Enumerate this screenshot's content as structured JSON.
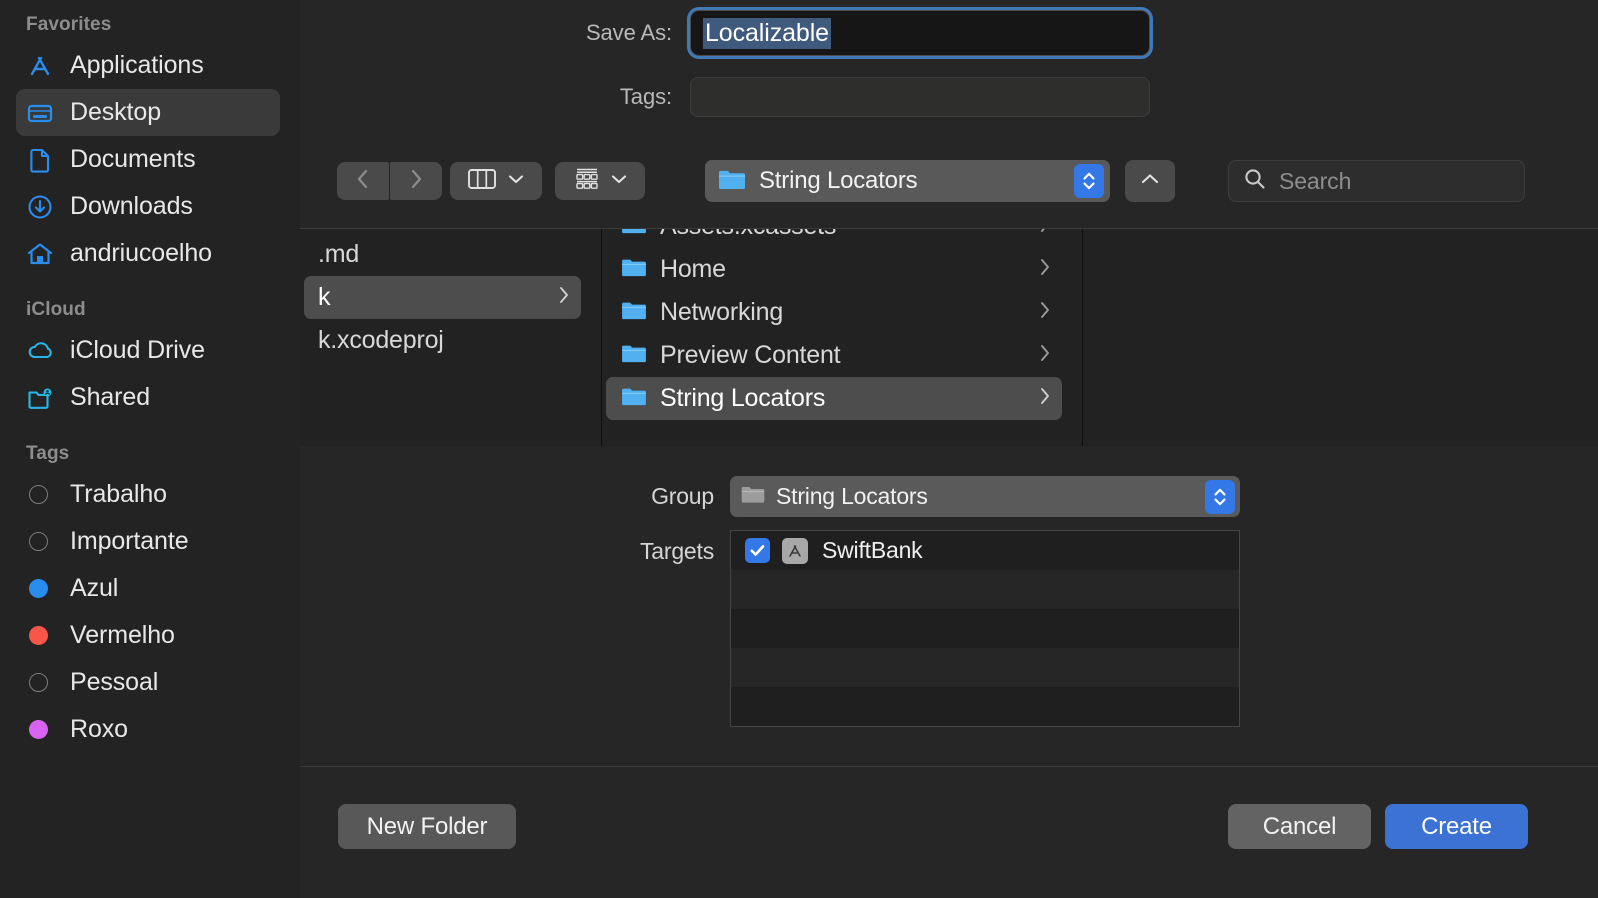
{
  "sidebar": {
    "sections": [
      {
        "title": "Favorites",
        "items": [
          {
            "label": "Applications",
            "icon": "applications-icon",
            "selected": false
          },
          {
            "label": "Desktop",
            "icon": "desktop-icon",
            "selected": true
          },
          {
            "label": "Documents",
            "icon": "document-icon",
            "selected": false
          },
          {
            "label": "Downloads",
            "icon": "downloads-icon",
            "selected": false
          },
          {
            "label": "andriucoelho",
            "icon": "home-icon",
            "selected": false
          }
        ]
      },
      {
        "title": "iCloud",
        "items": [
          {
            "label": "iCloud Drive",
            "icon": "cloud-icon",
            "selected": false
          },
          {
            "label": "Shared",
            "icon": "shared-folder-icon",
            "selected": false
          }
        ]
      },
      {
        "title": "Tags",
        "items": [
          {
            "label": "Trabalho",
            "icon": "tag-dot-icon",
            "color": "none"
          },
          {
            "label": "Importante",
            "icon": "tag-dot-icon",
            "color": "none"
          },
          {
            "label": "Azul",
            "icon": "tag-dot-icon",
            "color": "#2a8ced"
          },
          {
            "label": "Vermelho",
            "icon": "tag-dot-icon",
            "color": "#f9564a"
          },
          {
            "label": "Pessoal",
            "icon": "tag-dot-icon",
            "color": "none"
          },
          {
            "label": "Roxo",
            "icon": "tag-dot-icon",
            "color": "#d863f0"
          }
        ]
      }
    ]
  },
  "dialog": {
    "save_as": {
      "label": "Save As:",
      "value": "Localizable",
      "selected": true
    },
    "tags": {
      "label": "Tags:",
      "value": "",
      "placeholder": ""
    },
    "toolbar": {
      "back_icon": "chevron-left-icon",
      "forward_icon": "chevron-right-icon",
      "view_icon": "column-view-icon",
      "view_chevron": "chevron-down-icon",
      "group_icon": "group-by-icon",
      "group_chevron": "chevron-down-icon",
      "path_popup": {
        "label": "String Locators",
        "icon": "folder-icon",
        "stepper_icon": "stepper-updown-icon"
      },
      "up_button_icon": "chevron-up-icon",
      "search": {
        "icon": "search-icon",
        "placeholder": "Search",
        "value": ""
      }
    },
    "browser": {
      "columns": [
        {
          "name": "column-1",
          "rows": [
            {
              "label": ".md",
              "icon": "none",
              "selected": false,
              "disclosure": false
            },
            {
              "label": "k",
              "icon": "none",
              "selected": true,
              "disclosure": true
            },
            {
              "label": "k.xcodeproj",
              "icon": "none",
              "selected": false,
              "disclosure": false
            }
          ]
        },
        {
          "name": "column-2",
          "rows": [
            {
              "label": "Assets.xcassets",
              "icon": "folder-icon",
              "selected": false,
              "disclosure": true
            },
            {
              "label": "Home",
              "icon": "folder-icon",
              "selected": false,
              "disclosure": true
            },
            {
              "label": "Networking",
              "icon": "folder-icon",
              "selected": false,
              "disclosure": true
            },
            {
              "label": "Preview Content",
              "icon": "folder-icon",
              "selected": false,
              "disclosure": true
            },
            {
              "label": "String Locators",
              "icon": "folder-icon",
              "selected": true,
              "disclosure": true
            }
          ]
        },
        {
          "name": "column-3",
          "rows": []
        }
      ]
    },
    "accessory": {
      "group": {
        "label": "Group",
        "value": "String Locators",
        "icon": "folder-icon",
        "stepper_icon": "stepper-updown-icon"
      },
      "targets": {
        "label": "Targets",
        "rows": [
          {
            "name": "SwiftBank",
            "checked": true,
            "icon": "app-target-icon"
          },
          {
            "name": "",
            "checked": false,
            "icon": "none"
          },
          {
            "name": "",
            "checked": false,
            "icon": "none"
          },
          {
            "name": "",
            "checked": false,
            "icon": "none"
          },
          {
            "name": "",
            "checked": false,
            "icon": "none"
          }
        ]
      }
    },
    "buttons": {
      "new_folder": "New Folder",
      "cancel": "Cancel",
      "create": "Create"
    }
  },
  "colors": {
    "accent_blue": "#3478e8",
    "default_button": "#3b72d4",
    "folder_blue": "#5ab4f0",
    "icloud_cyan": "#27b6e8",
    "sidebar_icon_blue": "#2a8ced",
    "selection_text": "#3f5a7d"
  }
}
